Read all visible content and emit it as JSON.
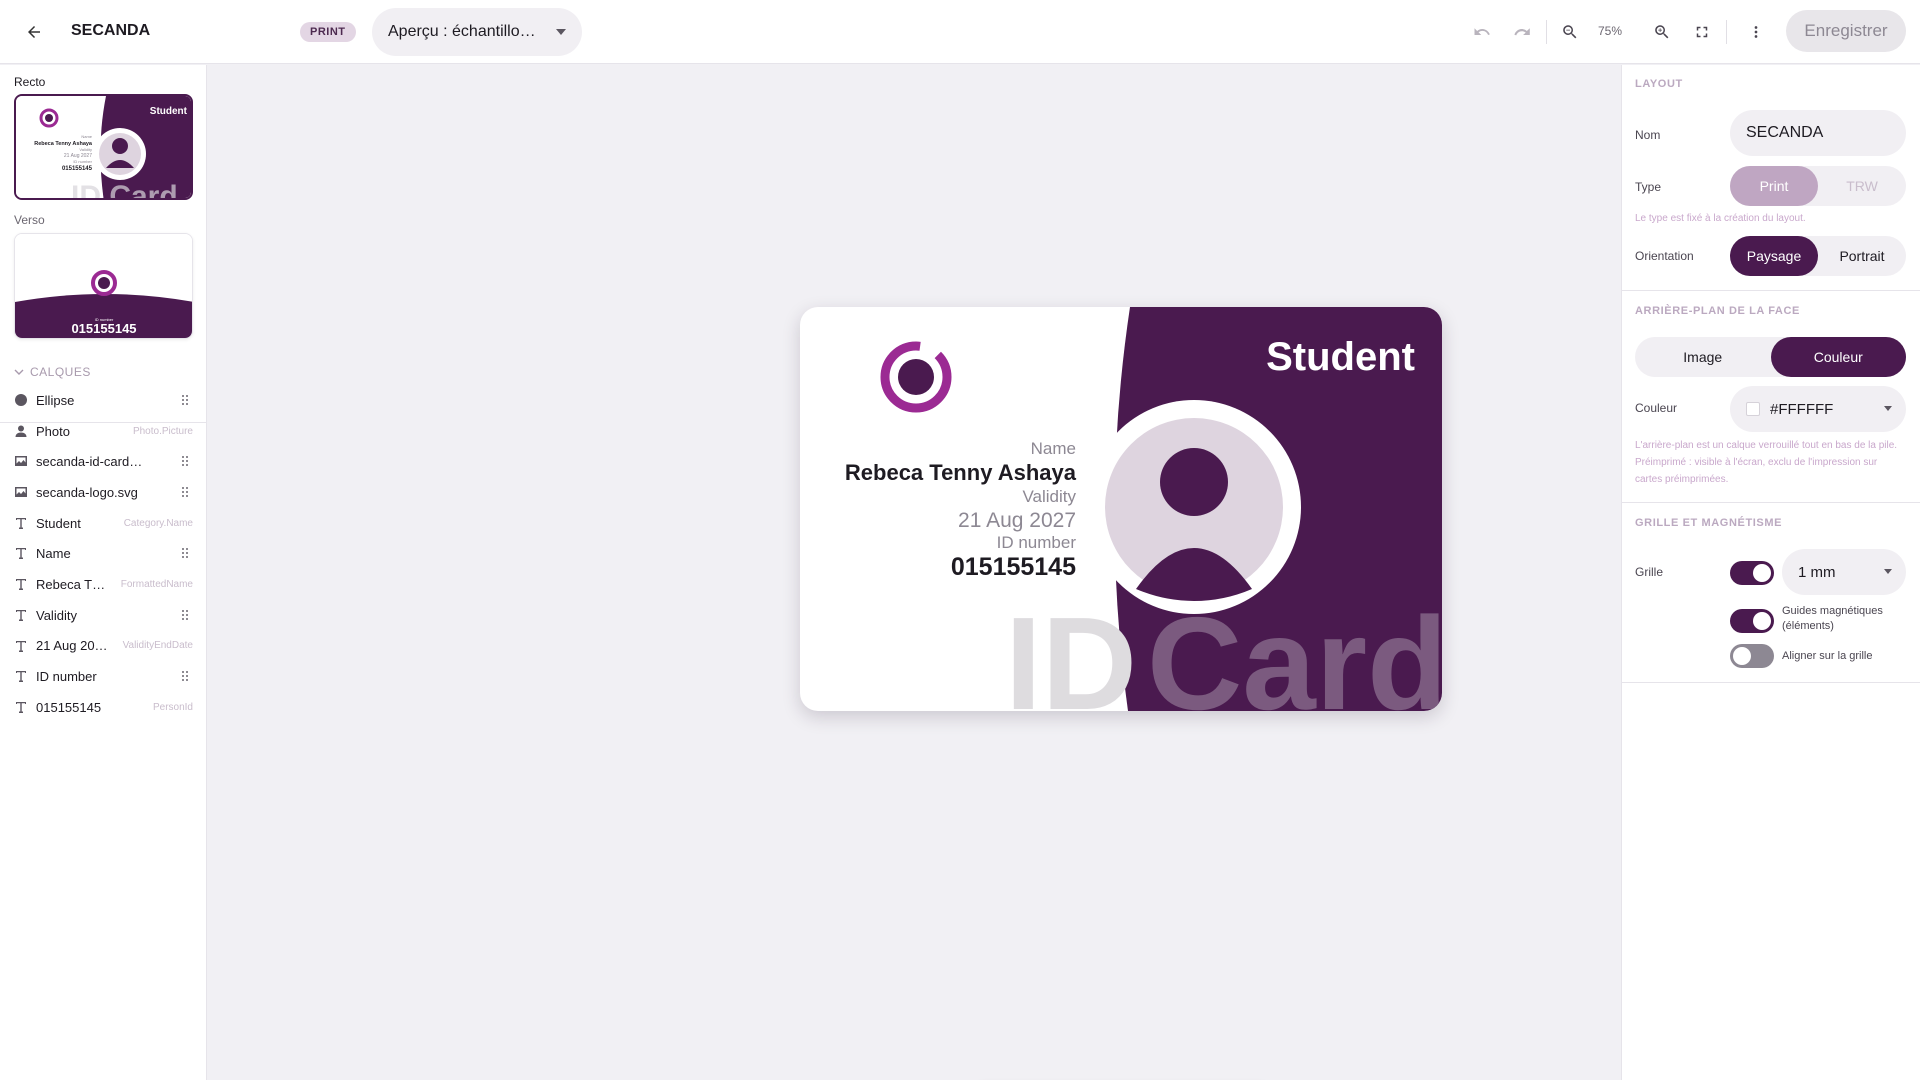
{
  "header": {
    "title": "SECANDA",
    "badge": "PRINT",
    "preview_select": "Aperçu : échantillo…",
    "zoom": "75%",
    "save_label": "Enregistrer"
  },
  "left": {
    "recto_label": "Recto",
    "verso_label": "Verso",
    "layers_title": "CALQUES",
    "thumb_recto": {
      "category": "Student",
      "name_label": "Name",
      "name": "Rebeca Tenny Ashaya",
      "validity_label": "Validity",
      "date": "21 Aug 2027",
      "id_label": "ID number",
      "id": "015155145",
      "watermark": "ID Card"
    },
    "thumb_verso": {
      "id_label": "ID number",
      "id": "015155145"
    },
    "layers": [
      {
        "name": "Ellipse",
        "hint": "",
        "icon": "circle-icon"
      },
      {
        "name": "Photo",
        "hint": "Photo.Picture",
        "icon": "person-icon"
      },
      {
        "name": "secanda-id-card-desi…",
        "hint": "",
        "icon": "image-icon"
      },
      {
        "name": "secanda-logo.svg",
        "hint": "",
        "icon": "image-icon"
      },
      {
        "name": "Student",
        "hint": "Category.Name",
        "icon": "text-icon"
      },
      {
        "name": "Name",
        "hint": "",
        "icon": "text-icon"
      },
      {
        "name": "Rebeca T…",
        "hint": "FormattedName",
        "icon": "text-icon"
      },
      {
        "name": "Validity",
        "hint": "",
        "icon": "text-icon"
      },
      {
        "name": "21 Aug 20…",
        "hint": "ValidityEndDate",
        "icon": "text-icon"
      },
      {
        "name": "ID number",
        "hint": "",
        "icon": "text-icon"
      },
      {
        "name": "015155145",
        "hint": "PersonId",
        "icon": "text-icon"
      }
    ]
  },
  "card": {
    "category": "Student",
    "name_label": "Name",
    "name": "Rebeca Tenny Ashaya",
    "validity_label": "Validity",
    "date": "21 Aug 2027",
    "id_label": "ID number",
    "id": "015155145",
    "watermark_left": "ID",
    "watermark_right": "Card",
    "colors": {
      "brand": "#4a1a4f",
      "logo": "#9b2a93",
      "photo_bg": "#ded4df"
    }
  },
  "right": {
    "layout_title": "LAYOUT",
    "name_label": "Nom",
    "name_value": "SECANDA",
    "type_label": "Type",
    "type_options": [
      "Print",
      "TRW"
    ],
    "type_selected": "Print",
    "type_note": "Le type est fixé à la création du layout.",
    "orientation_label": "Orientation",
    "orientation_options": [
      "Paysage",
      "Portrait"
    ],
    "orientation_selected": "Paysage",
    "bg_title": "ARRIÈRE-PLAN DE LA FACE",
    "bg_options": [
      "Image",
      "Couleur"
    ],
    "bg_selected": "Couleur",
    "color_label": "Couleur",
    "color_value": "#FFFFFF",
    "bg_note": "L'arrière-plan est un calque verrouillé tout en bas de la pile. Préimprimé : visible à l'écran, exclu de l'impression sur cartes préimprimées.",
    "grid_title": "GRILLE ET MAGNÉTISME",
    "grid_label": "Grille",
    "grid_on": true,
    "grid_size": "1 mm",
    "guides_label": "Guides magnétiques (éléments)",
    "guides_on": true,
    "snap_label": "Aligner sur la grille",
    "snap_on": false
  },
  "tools": [
    "cursor-icon",
    "text-icon",
    "person-icon",
    "image-icon",
    "barcode-icon",
    "qrcode-icon",
    "rectangle-icon",
    "ellipse-icon"
  ]
}
